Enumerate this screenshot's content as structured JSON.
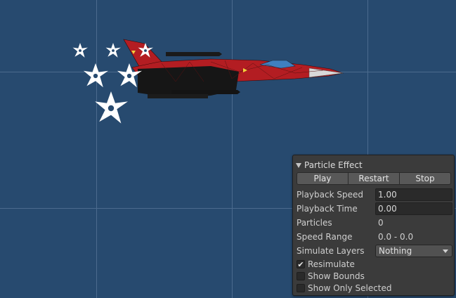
{
  "panel": {
    "title": "Particle Effect",
    "buttons": {
      "play": "Play",
      "restart": "Restart",
      "stop": "Stop"
    },
    "playback_speed": {
      "label": "Playback Speed",
      "value": "1.00"
    },
    "playback_time": {
      "label": "Playback Time",
      "value": "0.00"
    },
    "particles": {
      "label": "Particles",
      "value": "0"
    },
    "speed_range": {
      "label": "Speed Range",
      "value": "0.0 - 0.0"
    },
    "simulate_layers": {
      "label": "Simulate Layers",
      "value": "Nothing"
    },
    "resimulate": {
      "label": "Resimulate",
      "checked": true,
      "mark": "✔"
    },
    "show_bounds": {
      "label": "Show Bounds",
      "checked": false
    },
    "show_only_selected": {
      "label": "Show Only Selected",
      "checked": false
    }
  },
  "colors": {
    "scene_background": "#274a6f",
    "grid_line": "#4a6a8d",
    "panel_background": "#3b3b3b",
    "jet_red": "#b31d22"
  }
}
